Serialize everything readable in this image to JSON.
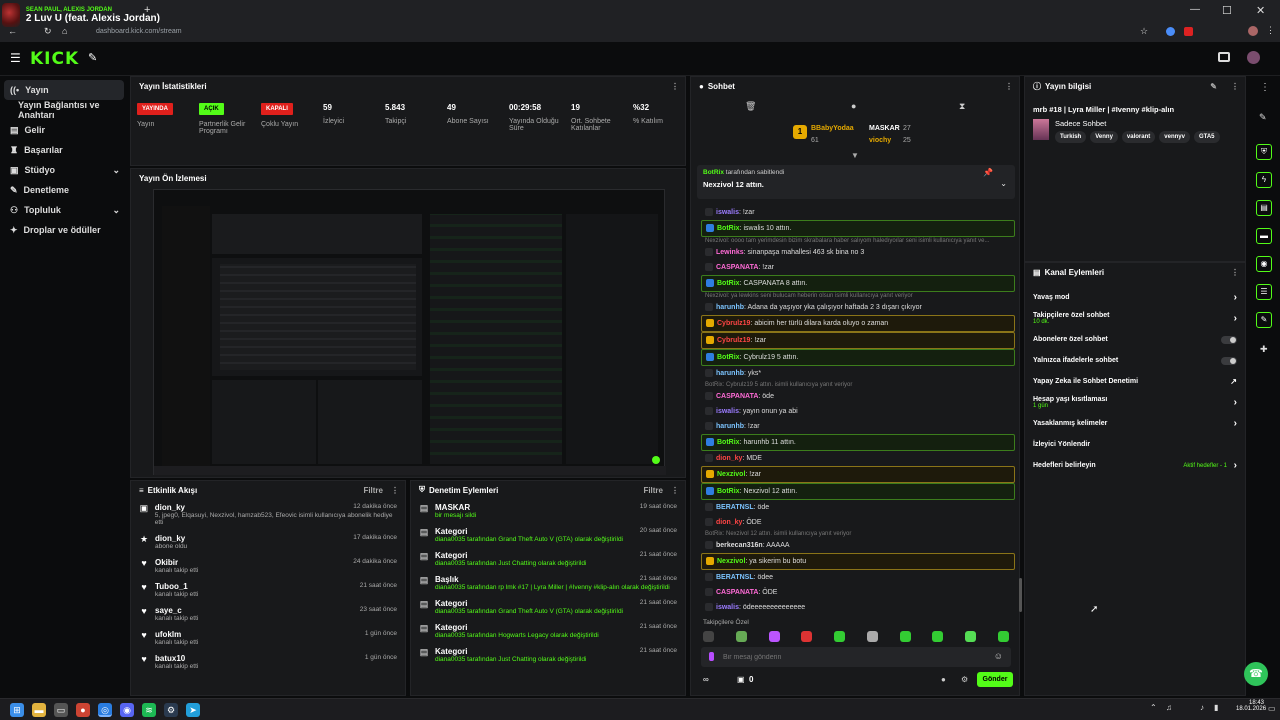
{
  "browser": {
    "media_artist": "SEAN PAUL, ALEXIS JORDAN",
    "media_song": "2 Luv U (feat. Alexis Jordan)",
    "url": "dashboard.kick.com/stream"
  },
  "app": {
    "logo": "KICK"
  },
  "sidebar": {
    "items": [
      {
        "label": "Yayın",
        "icon": "broadcast-icon"
      },
      {
        "label": "Yayın Bağlantısı ve Anahtarı",
        "icon": ""
      },
      {
        "label": "Gelir",
        "icon": "wallet-icon"
      },
      {
        "label": "Başarılar",
        "icon": "trophy-icon"
      },
      {
        "label": "Stüdyo",
        "icon": "studio-icon"
      },
      {
        "label": "Denetleme",
        "icon": "wrench-icon"
      },
      {
        "label": "Topluluk",
        "icon": "community-icon"
      },
      {
        "label": "Droplar ve ödüller",
        "icon": "gift-icon"
      }
    ]
  },
  "stats": {
    "title": "Yayın İstatistikleri",
    "items": [
      {
        "tag": "YAYINDA",
        "label": "Yayın",
        "color": "#e0201c"
      },
      {
        "tag": "AÇIK",
        "label": "Partnerlik Gelir Programı",
        "color": "#53fc18"
      },
      {
        "tag": "KAPALI",
        "label": "Çoklu Yayın",
        "color": "#e0201c"
      },
      {
        "value": "59",
        "label": "İzleyici"
      },
      {
        "value": "5.843",
        "label": "Takipçi"
      },
      {
        "value": "49",
        "label": "Abone Sayısı"
      },
      {
        "value": "00:29:58",
        "label": "Yayında Olduğu Süre"
      },
      {
        "value": "19",
        "label": "Ort. Sohbete Katılanlar"
      },
      {
        "value": "%32",
        "label": "% Katılım"
      }
    ]
  },
  "preview": {
    "title": "Yayın Ön İzlemesi"
  },
  "activity": {
    "title": "Etkinlik Akışı",
    "filter": "Filtre",
    "items": [
      {
        "name": "dion_ky",
        "desc": "5, jpeg0, Elqasuyi, Nexzivol, hamzab523, Efeovic isimli kullanıcıya abonelik hediye etti",
        "time": "12 dakika önce",
        "icon": "gift-icon"
      },
      {
        "name": "dion_ky",
        "desc": "abone oldu",
        "time": "17 dakika önce",
        "icon": "star-icon"
      },
      {
        "name": "Okibir",
        "desc": "kanalı takip etti",
        "time": "24 dakika önce",
        "icon": "heart-icon"
      },
      {
        "name": "Tuboo_1",
        "desc": "kanalı takip etti",
        "time": "21 saat önce",
        "icon": "heart-icon"
      },
      {
        "name": "saye_c",
        "desc": "kanalı takip etti",
        "time": "23 saat önce",
        "icon": "heart-icon"
      },
      {
        "name": "ufoklm",
        "desc": "kanalı takip etti",
        "time": "1 gün önce",
        "icon": "heart-icon"
      },
      {
        "name": "batux10",
        "desc": "kanalı takip etti",
        "time": "1 gün önce",
        "icon": "heart-icon"
      }
    ]
  },
  "modlog": {
    "title": "Denetim Eylemleri",
    "filter": "Filtre",
    "items": [
      {
        "name": "MASKAR",
        "line": "bir mesajı sildi",
        "time": "19 saat önce"
      },
      {
        "name": "Kategori",
        "line": "diana0035 tarafından Grand Theft Auto V (GTA) olarak değiştirildi",
        "time": "20 saat önce"
      },
      {
        "name": "Kategori",
        "line": "diana0035 tarafından Just Chatting olarak değiştirildi",
        "time": "21 saat önce"
      },
      {
        "name": "Başlık",
        "line": "diana0035 tarafından rp lmk #17 | Lyra Miller | #Ivenny #klip-alın olarak değiştirildi",
        "time": "21 saat önce"
      },
      {
        "name": "Kategori",
        "line": "diana0035 tarafından Grand Theft Auto V (GTA) olarak değiştirildi",
        "time": "21 saat önce"
      },
      {
        "name": "Kategori",
        "line": "diana0035 tarafından Hogwarts Legacy olarak değiştirildi",
        "time": "21 saat önce"
      },
      {
        "name": "Kategori",
        "line": "diana0035 tarafından Just Chatting olarak değiştirildi",
        "time": "21 saat önce"
      }
    ]
  },
  "chat": {
    "title": "Sohbet",
    "leader1_name": "BBabyYodaa",
    "leader1_val": "61",
    "leader2_name": "MASKAR",
    "leader2_val": "27",
    "leader3_name": "viochy",
    "leader3_val": "25",
    "pinned_by": "BotRix",
    "pinned_suffix": "tarafından sabitlendi",
    "pinned_msg": "Nexzivol 12 attın.",
    "messages": [
      {
        "t": "n",
        "u": "iswalis",
        "uc": "#9b7cff",
        "m": ": !zar"
      },
      {
        "t": "hl",
        "u": "BotRix",
        "uc": "#53fc18",
        "m": ": iswalis 10 attın."
      },
      {
        "t": "r",
        "m": "Nexzivol: oooo tam yerimdesin bizim skrabalara haber salıyom haledıyoılar seni isimli kullanıcıya yanıt ve..."
      },
      {
        "t": "n",
        "u": "Lewinks",
        "uc": "#ff6bd6",
        "m": ": sinanpaşa mahallesi 463 sk bina no 3"
      },
      {
        "t": "n",
        "u": "CASPANATA",
        "uc": "#ff6bd6",
        "m": ": !zar"
      },
      {
        "t": "hl",
        "u": "BotRix",
        "uc": "#53fc18",
        "m": ": CASPANATA 8 attın."
      },
      {
        "t": "r",
        "m": "Nexzivol: ya lewkins seni bulucam heberin olsun isimli kullanıcıya yanıt veriyor"
      },
      {
        "t": "n",
        "u": "harunhb",
        "uc": "#7cc4ff",
        "m": ": Adana da yaşıyor yka çalışıyor haftada 2 3 dışarı çıkıyor"
      },
      {
        "t": "g",
        "u": "Cybrulz19",
        "uc": "#ff4545",
        "m": ": abicim her türlü dilara karda oluyo o zaman"
      },
      {
        "t": "g",
        "u": "Cybrulz19",
        "uc": "#ff4545",
        "m": ": !zar"
      },
      {
        "t": "hl",
        "u": "BotRix",
        "uc": "#53fc18",
        "m": ": Cybrulz19 5 attın."
      },
      {
        "t": "n",
        "u": "harunhb",
        "uc": "#7cc4ff",
        "m": ": yks*"
      },
      {
        "t": "r",
        "m": "BotRix: Cybrulz19 5 attın. isimli kullanıcıya yanıt veriyor"
      },
      {
        "t": "n",
        "u": "CASPANATA",
        "uc": "#ff6bd6",
        "m": ": öde"
      },
      {
        "t": "n",
        "u": "iswalis",
        "uc": "#9b7cff",
        "m": ": yayın onun ya abi"
      },
      {
        "t": "n",
        "u": "harunhb",
        "uc": "#7cc4ff",
        "m": ": !zar"
      },
      {
        "t": "hl",
        "u": "BotRix",
        "uc": "#53fc18",
        "m": ": harunhb 11 attın."
      },
      {
        "t": "n",
        "u": "dion_ky",
        "uc": "#ff4545",
        "m": ": MDE"
      },
      {
        "t": "g",
        "u": "Nexzivol",
        "uc": "#53fc18",
        "m": ": !zar"
      },
      {
        "t": "hl",
        "u": "BotRix",
        "uc": "#53fc18",
        "m": ": Nexzivol 12 attın."
      },
      {
        "t": "n",
        "u": "BERATNSL",
        "uc": "#7cc4ff",
        "m": ": öde"
      },
      {
        "t": "n",
        "u": "dion_ky",
        "uc": "#ff4545",
        "m": ": ÖDE"
      },
      {
        "t": "r",
        "m": "BotRix: Nexzivol 12 attın. isimli kullanıcıya yanıt veriyor"
      },
      {
        "t": "n",
        "u": "berkecan316n",
        "uc": "#dddddd",
        "m": ": AAAAA"
      },
      {
        "t": "g",
        "u": "Nexzivol",
        "uc": "#53fc18",
        "m": ": ya sikerim bu botu"
      },
      {
        "t": "n",
        "u": "BERATNSL",
        "uc": "#7cc4ff",
        "m": ": ödee"
      },
      {
        "t": "n",
        "u": "CASPANATA",
        "uc": "#ff6bd6",
        "m": ": ÖDE"
      },
      {
        "t": "n",
        "u": "iswalis",
        "uc": "#9b7cff",
        "m": ": ödeeeeeeeeeeeeee"
      }
    ],
    "followers_label": "Takipçilere Özel",
    "input_placeholder": "Bir mesaj gönderin",
    "count": "0",
    "send": "Gönder"
  },
  "stream_info": {
    "title": "Yayın bilgisi",
    "stream_title": "mrb #18 | Lyra Miller | #Ivenny #klip-alın",
    "category": "Sadece Sohbet",
    "tags": [
      "Turkish",
      "Venny",
      "valorant",
      "vennyv",
      "GTA5"
    ]
  },
  "channel_actions": {
    "title": "Kanal Eylemleri",
    "items": [
      {
        "label": "Yavaş mod",
        "sub": "",
        "ctrl": "chev"
      },
      {
        "label": "Takipçilere özel sohbet",
        "sub": "10 dk.",
        "ctrl": "chev"
      },
      {
        "label": "Abonelere özel sohbet",
        "sub": "",
        "ctrl": "toggle"
      },
      {
        "label": "Yalnızca ifadelerle sohbet",
        "sub": "",
        "ctrl": "toggle"
      },
      {
        "label": "Yapay Zeka ile Sohbet Denetimi",
        "sub": "",
        "ctrl": "ext"
      },
      {
        "label": "Hesap yaşı kısıtlaması",
        "sub": "1 gün",
        "ctrl": "chev"
      },
      {
        "label": "Yasaklanmış kelimeler",
        "sub": "",
        "ctrl": "chev"
      },
      {
        "label": "İzleyici Yönlendir",
        "sub": "",
        "ctrl": ""
      },
      {
        "label": "Hedefleri belirleyin",
        "sub": "",
        "ctrl": "chev",
        "extra": "Aktif hedefler - 1"
      }
    ]
  },
  "taskbar": {
    "time": "18:43",
    "date": "18.01.2026"
  }
}
